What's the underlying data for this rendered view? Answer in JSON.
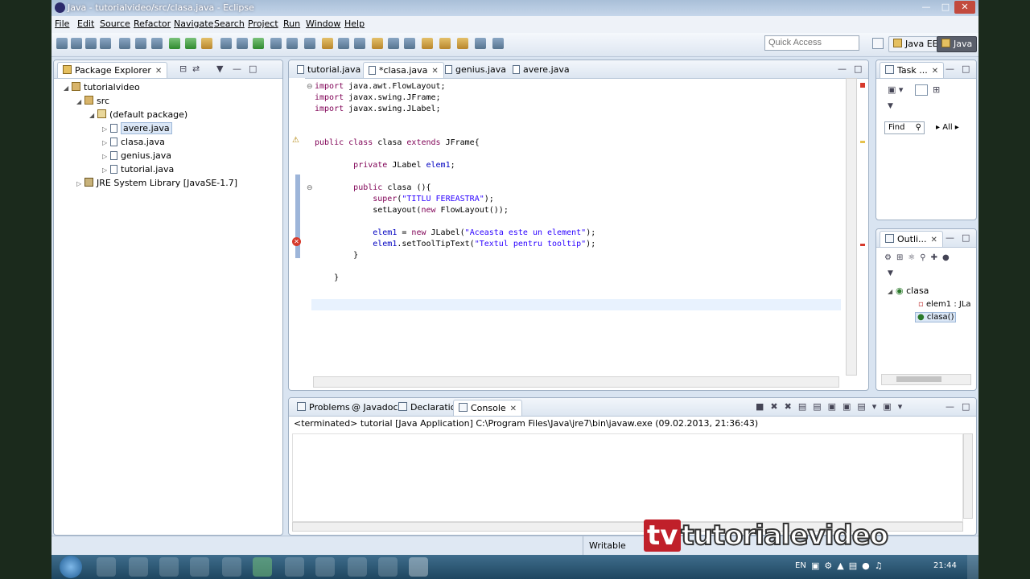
{
  "window": {
    "title": "Java - tutorialvideo/src/clasa.java - Eclipse"
  },
  "menu": [
    "File",
    "Edit",
    "Source",
    "Refactor",
    "Navigate",
    "Search",
    "Project",
    "Run",
    "Window",
    "Help"
  ],
  "toolbar": {
    "quick_access": "Quick Access",
    "perspective_java_ee": "Java EE",
    "perspective_java": "Java"
  },
  "package_explorer": {
    "tab_label": "Package Explorer",
    "tree": [
      {
        "label": "tutorialvideo",
        "level": 0,
        "type": "project"
      },
      {
        "label": "src",
        "level": 1,
        "type": "folder"
      },
      {
        "label": "(default package)",
        "level": 2,
        "type": "package"
      },
      {
        "label": "avere.java",
        "level": 3,
        "type": "file",
        "selected": true
      },
      {
        "label": "clasa.java",
        "level": 3,
        "type": "file"
      },
      {
        "label": "genius.java",
        "level": 3,
        "type": "file"
      },
      {
        "label": "tutorial.java",
        "level": 3,
        "type": "file"
      },
      {
        "label": "JRE System Library [JavaSE-1.7]",
        "level": 1,
        "type": "library"
      }
    ]
  },
  "editor": {
    "tabs": [
      "tutorial.java",
      "*clasa.java",
      "genius.java",
      "avere.java"
    ],
    "active_tab": 1,
    "code": [
      "import java.awt.FlowLayout;",
      "import javax.swing.JFrame;",
      "import javax.swing.JLabel;",
      "",
      "",
      "public class clasa extends JFrame{",
      "",
      "        private JLabel elem1;",
      "",
      "        public clasa (){",
      "            super(\"TITLU FEREASTRA\");",
      "            setLayout(new FlowLayout());",
      "",
      "            elem1 = new JLabel(\"Aceasta este un element\");",
      "            elem1.setToolTipText(\"Textul pentru tooltip\");",
      "        }",
      "",
      "    }"
    ]
  },
  "task_list": {
    "tab_label": "Task ...",
    "find_placeholder": "Find",
    "all_label": "All"
  },
  "outline": {
    "tab_label": "Outli...",
    "items": [
      {
        "label": "clasa",
        "level": 0
      },
      {
        "label": "elem1 : JLa",
        "level": 1
      },
      {
        "label": "clasa()",
        "level": 1,
        "selected": true
      }
    ]
  },
  "bottom_panel": {
    "tabs": [
      "Problems",
      "Javadoc",
      "Declaration",
      "Console"
    ],
    "active_tab": 3,
    "console_status": "<terminated> tutorial [Java Application] C:\\Program Files\\Java\\jre7\\bin\\javaw.exe (09.02.2013, 21:36:43)"
  },
  "statusbar": {
    "writable": "Writable"
  },
  "taskbar": {
    "lang": "EN",
    "time": "21:44"
  },
  "watermark": {
    "tv": "tv",
    "text": "tutorialevideo"
  }
}
